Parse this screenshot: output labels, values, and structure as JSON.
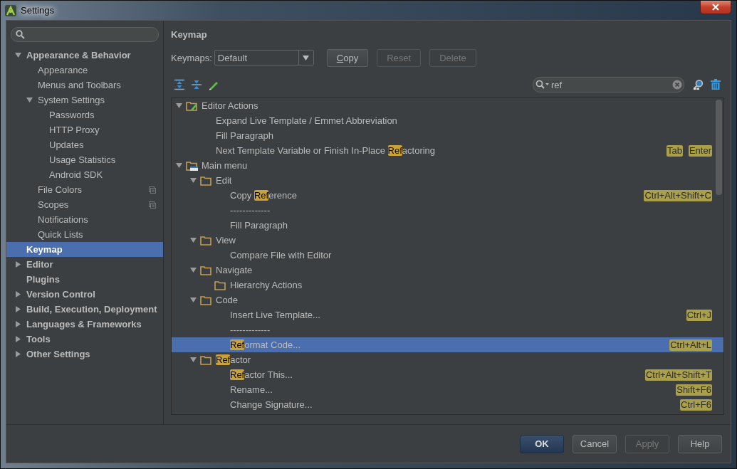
{
  "window": {
    "title": "Settings"
  },
  "sidebar": {
    "items": [
      {
        "label": "Appearance & Behavior",
        "selected": false,
        "expanded": true,
        "children": [
          {
            "label": "Appearance",
            "selected": false
          },
          {
            "label": "Menus and Toolbars",
            "selected": false
          },
          {
            "label": "System Settings",
            "selected": false,
            "expanded": true,
            "children": [
              {
                "label": "Passwords",
                "selected": false
              },
              {
                "label": "HTTP Proxy",
                "selected": false
              },
              {
                "label": "Updates",
                "selected": false
              },
              {
                "label": "Usage Statistics",
                "selected": false
              },
              {
                "label": "Android SDK",
                "selected": false
              }
            ]
          },
          {
            "label": "File Colors",
            "selected": false,
            "project_level": true
          },
          {
            "label": "Scopes",
            "selected": false,
            "project_level": true
          },
          {
            "label": "Notifications",
            "selected": false
          },
          {
            "label": "Quick Lists",
            "selected": false
          }
        ]
      },
      {
        "label": "Keymap",
        "selected": true
      },
      {
        "label": "Editor",
        "selected": false,
        "expanded": false
      },
      {
        "label": "Plugins",
        "selected": false
      },
      {
        "label": "Version Control",
        "selected": false,
        "expanded": false
      },
      {
        "label": "Build, Execution, Deployment",
        "selected": false,
        "expanded": false
      },
      {
        "label": "Languages & Frameworks",
        "selected": false,
        "expanded": false
      },
      {
        "label": "Tools",
        "selected": false,
        "expanded": false
      },
      {
        "label": "Other Settings",
        "selected": false,
        "expanded": false
      }
    ]
  },
  "keymap": {
    "title": "Keymap",
    "keymaps_label": "Keymaps:",
    "keymap_value": "Default",
    "buttons": [
      {
        "label": "Copy",
        "mnemonic": true,
        "disabled": false
      },
      {
        "label": "Reset",
        "disabled": true
      },
      {
        "label": "Delete",
        "disabled": true
      }
    ],
    "filter": {
      "value": "ref"
    },
    "tree": [
      {
        "kind": "editor-group",
        "label": "Editor Actions",
        "expanded": true,
        "selected": false,
        "children": [
          {
            "kind": "action",
            "label": "Expand Live Template / Emmet Abbreviation",
            "selected": false
          },
          {
            "kind": "action",
            "label": "Fill Paragraph",
            "selected": false
          },
          {
            "kind": "action",
            "label": "Next Template Variable or Finish In-Place **Ref**actoring",
            "selected": false,
            "shortcuts": [
              "Tab",
              "Enter"
            ]
          }
        ]
      },
      {
        "kind": "menu-group",
        "label": "Main menu",
        "expanded": true,
        "selected": false,
        "children": [
          {
            "kind": "folder",
            "label": "Edit",
            "expanded": true,
            "selected": false,
            "children": [
              {
                "kind": "action",
                "label": "Copy **Ref**erence",
                "selected": false,
                "shortcuts": [
                  "Ctrl+Alt+Shift+C"
                ]
              },
              {
                "kind": "separator",
                "label": "-------------",
                "selected": false
              },
              {
                "kind": "action",
                "label": "Fill Paragraph",
                "selected": false
              }
            ]
          },
          {
            "kind": "folder",
            "label": "View",
            "expanded": true,
            "selected": false,
            "children": [
              {
                "kind": "action",
                "label": "Compare File with Editor",
                "selected": false
              }
            ]
          },
          {
            "kind": "folder",
            "label": "Navigate",
            "expanded": true,
            "selected": false,
            "children": [
              {
                "kind": "folder",
                "label": "Hierarchy Actions",
                "selected": false
              }
            ]
          },
          {
            "kind": "folder",
            "label": "Code",
            "expanded": true,
            "selected": false,
            "children": [
              {
                "kind": "action",
                "label": "Insert Live Template...",
                "selected": false,
                "shortcuts": [
                  "Ctrl+J"
                ]
              },
              {
                "kind": "separator",
                "label": "-------------",
                "selected": false
              },
              {
                "kind": "action",
                "label": "**Ref**ormat Code...",
                "selected": true,
                "shortcuts": [
                  "Ctrl+Alt+L"
                ]
              }
            ]
          },
          {
            "kind": "folder",
            "label": "**Ref**actor",
            "expanded": true,
            "selected": false,
            "children": [
              {
                "kind": "action",
                "label": "**Ref**actor This...",
                "selected": false,
                "shortcuts": [
                  "Ctrl+Alt+Shift+T"
                ]
              },
              {
                "kind": "action",
                "label": "Rename...",
                "selected": false,
                "shortcuts": [
                  "Shift+F6"
                ]
              },
              {
                "kind": "action",
                "label": "Change Signature...",
                "selected": false,
                "shortcuts": [
                  "Ctrl+F6"
                ]
              }
            ]
          }
        ]
      }
    ]
  },
  "footer": {
    "buttons": [
      {
        "label": "OK",
        "kind": "default",
        "disabled": false
      },
      {
        "label": "Cancel",
        "kind": "normal",
        "disabled": false
      },
      {
        "label": "Apply",
        "kind": "normal",
        "disabled": true
      },
      {
        "label": "Help",
        "kind": "normal",
        "disabled": false
      }
    ]
  }
}
